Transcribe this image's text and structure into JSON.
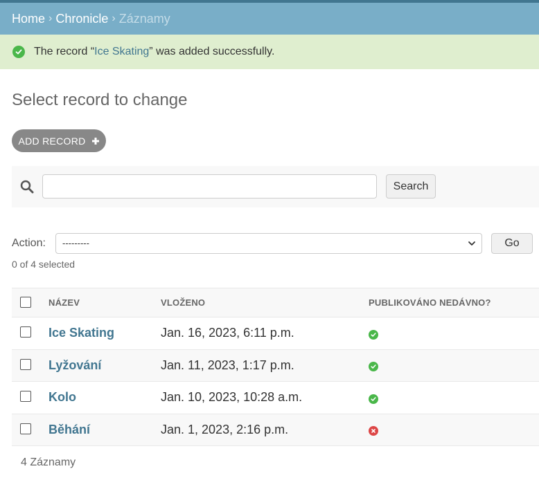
{
  "breadcrumbs": {
    "home": "Home",
    "app": "Chronicle",
    "current": "Záznamy",
    "separator": "›"
  },
  "message": {
    "prefix": "The record “",
    "link": "Ice Skating",
    "suffix": "” was added successfully."
  },
  "page_title": "Select record to change",
  "add_button": "ADD RECORD",
  "search": {
    "value": "",
    "button": "Search"
  },
  "actions": {
    "label": "Action:",
    "selected_option": "---------",
    "go": "Go",
    "selected_count": "0 of 4 selected"
  },
  "table": {
    "headers": [
      "NÁZEV",
      "VLOŽENO",
      "PUBLIKOVÁNO NEDÁVNO?"
    ],
    "rows": [
      {
        "name": "Ice Skating",
        "date": "Jan. 16, 2023, 6:11 p.m.",
        "recent": true
      },
      {
        "name": "Lyžování",
        "date": "Jan. 11, 2023, 1:17 p.m.",
        "recent": true
      },
      {
        "name": "Kolo",
        "date": "Jan. 10, 2023, 10:28 a.m.",
        "recent": true
      },
      {
        "name": "Běhání",
        "date": "Jan. 1, 2023, 2:16 p.m.",
        "recent": false
      }
    ]
  },
  "paginator": "4 Záznamy",
  "colors": {
    "header": "#79aec8",
    "link": "#417690",
    "success_bg": "#dfeecf",
    "ok": "#4ab74a",
    "no": "#dd4646"
  }
}
